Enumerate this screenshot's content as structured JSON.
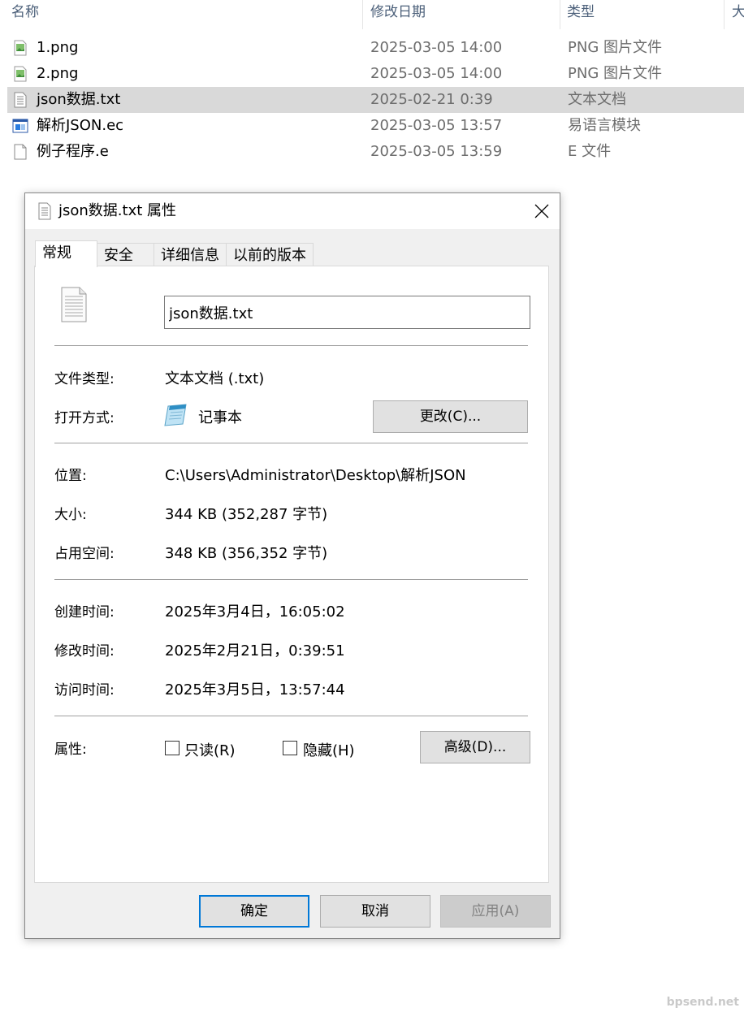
{
  "explorer": {
    "columns": {
      "name": "名称",
      "date": "修改日期",
      "type": "类型",
      "size": "大"
    },
    "files": [
      {
        "name": "1.png",
        "date": "2025-03-05 14:00",
        "type": "PNG 图片文件",
        "icon": "png-file-icon"
      },
      {
        "name": "2.png",
        "date": "2025-03-05 14:00",
        "type": "PNG 图片文件",
        "icon": "png-file-icon"
      },
      {
        "name": "json数据.txt",
        "date": "2025-02-21 0:39",
        "type": "文本文档",
        "icon": "text-file-icon"
      },
      {
        "name": "解析JSON.ec",
        "date": "2025-03-05 13:57",
        "type": "易语言模块",
        "icon": "ec-module-icon"
      },
      {
        "name": "例子程序.e",
        "date": "2025-03-05 13:59",
        "type": "E 文件",
        "icon": "blank-file-icon"
      }
    ]
  },
  "dialog": {
    "title": "json数据.txt 属性",
    "tabs": [
      "常规",
      "安全",
      "详细信息",
      "以前的版本"
    ],
    "filename": "json数据.txt",
    "file_type_label": "文件类型:",
    "file_type_value": "文本文档 (.txt)",
    "open_with_label": "打开方式:",
    "open_with_value": "记事本",
    "change_button": "更改(C)...",
    "location_label": "位置:",
    "location_value": "C:\\Users\\Administrator\\Desktop\\解析JSON",
    "size_label": "大小:",
    "size_value": "344 KB (352,287 字节)",
    "disk_size_label": "占用空间:",
    "disk_size_value": "348 KB (356,352 字节)",
    "created_label": "创建时间:",
    "created_value": "2025年3月4日，16:05:02",
    "modified_label": "修改时间:",
    "modified_value": "2025年2月21日，0:39:51",
    "accessed_label": "访问时间:",
    "accessed_value": "2025年3月5日，13:57:44",
    "attributes_label": "属性:",
    "readonly_label": "只读(R)",
    "hidden_label": "隐藏(H)",
    "advanced_button": "高级(D)...",
    "ok_button": "确定",
    "cancel_button": "取消",
    "apply_button": "应用(A)"
  },
  "watermark": "bpsend.net",
  "colors": {
    "selection": "#d9d9d9",
    "focus_border": "#0078d7",
    "header_text": "#4c607a"
  }
}
